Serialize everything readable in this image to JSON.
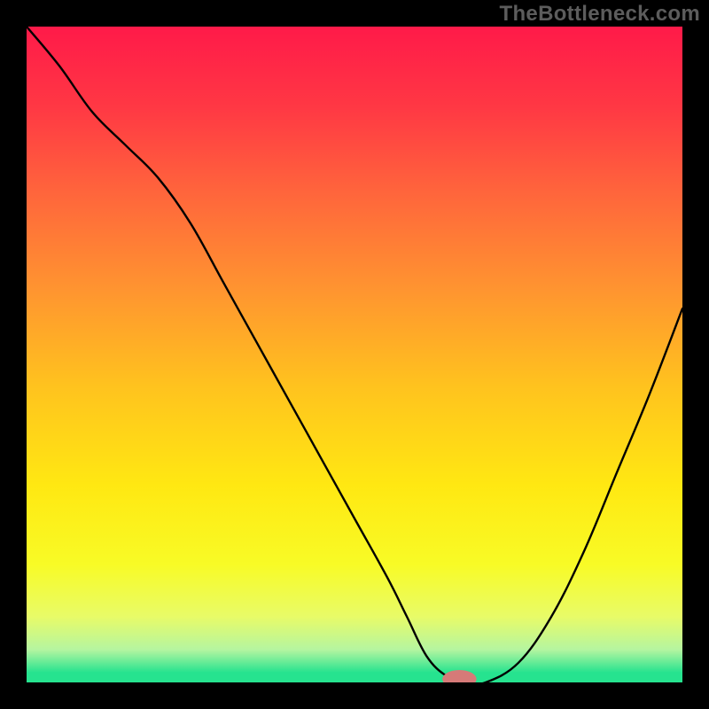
{
  "watermark": "TheBottleneck.com",
  "chart_data": {
    "type": "line",
    "title": "",
    "xlabel": "",
    "ylabel": "",
    "xlim": [
      0,
      100
    ],
    "ylim": [
      0,
      100
    ],
    "grid": false,
    "legend": false,
    "background_gradient": [
      {
        "stop": 0.0,
        "color": "#ff1a49"
      },
      {
        "stop": 0.12,
        "color": "#ff3744"
      },
      {
        "stop": 0.25,
        "color": "#ff643c"
      },
      {
        "stop": 0.4,
        "color": "#ff9430"
      },
      {
        "stop": 0.55,
        "color": "#ffc31e"
      },
      {
        "stop": 0.7,
        "color": "#ffe812"
      },
      {
        "stop": 0.82,
        "color": "#f8fb26"
      },
      {
        "stop": 0.9,
        "color": "#e8fb68"
      },
      {
        "stop": 0.95,
        "color": "#b5f5a0"
      },
      {
        "stop": 0.985,
        "color": "#26e38f"
      },
      {
        "stop": 1.0,
        "color": "#26e38f"
      }
    ],
    "series": [
      {
        "name": "bottleneck-curve",
        "type": "line",
        "color": "#000000",
        "x": [
          0,
          5,
          10,
          15,
          20,
          25,
          30,
          35,
          40,
          45,
          50,
          55,
          58,
          61,
          64,
          67,
          70,
          75,
          80,
          85,
          90,
          95,
          100
        ],
        "y": [
          100,
          94,
          87,
          82,
          77,
          70,
          61,
          52,
          43,
          34,
          25,
          16,
          10,
          4,
          1,
          0,
          0,
          3,
          10,
          20,
          32,
          44,
          57
        ]
      }
    ],
    "marker": {
      "name": "optimal-point",
      "x": 66,
      "y": 0.5,
      "color": "#d67a78",
      "rx": 2.6,
      "ry": 1.4
    }
  }
}
